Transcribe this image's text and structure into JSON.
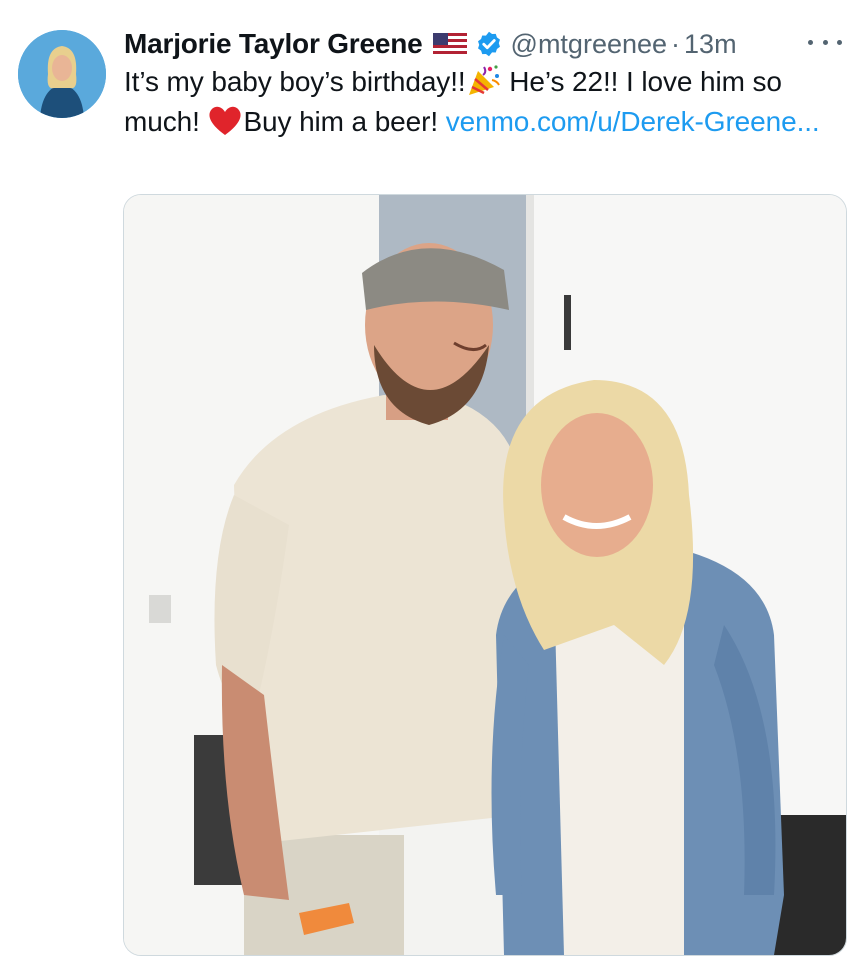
{
  "tweet": {
    "author_name": "Marjorie Taylor Greene",
    "handle": "@mtgreenee",
    "separator": "·",
    "time": "13m",
    "text_part1": "It’s my baby boy’s birthday!!",
    "text_part2": " He’s 22!! I love him so much! ",
    "text_part3": "Buy him a beer! ",
    "link_text": "venmo.com/u/Derek-Greene...",
    "icons": {
      "flag": "us-flag-icon",
      "verified": "verified-badge-icon",
      "party": "party-popper-icon",
      "heart": "red-heart-icon",
      "more": "more-options-icon"
    },
    "colors": {
      "link": "#1d9bf0",
      "verified": "#1d9bf0",
      "secondary_text": "#536471"
    }
  }
}
